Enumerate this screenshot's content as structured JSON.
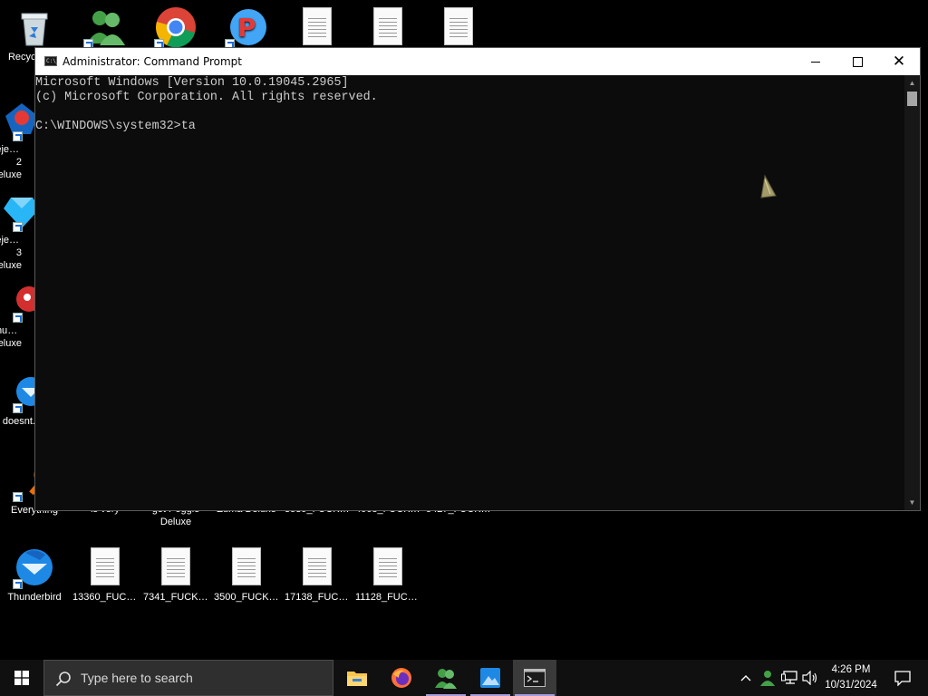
{
  "desktop": {
    "icons_left": [
      {
        "label": "Recycle Bin",
        "icon": "recycle-bin-icon"
      },
      {
        "label": "Bejeweled 2 Deluxe",
        "icon": "bejeweled-2-icon"
      },
      {
        "label": "Bejeweled 3 Deluxe",
        "icon": "bejeweled-3-icon"
      },
      {
        "label": "Chuzzle Deluxe",
        "icon": "chuzzle-icon"
      },
      {
        "label": "doesnt...",
        "icon": "thunderbird-icon"
      },
      {
        "label": "Everything",
        "icon": "everything-search-icon"
      }
    ],
    "icons_top": [
      {
        "label": "",
        "icon": "people-app-icon"
      },
      {
        "label": "",
        "icon": "chrome-icon"
      },
      {
        "label": "",
        "icon": "peggle-icon"
      },
      {
        "label": "",
        "icon": "text-document-icon"
      },
      {
        "label": "",
        "icon": "text-document-icon"
      },
      {
        "label": "",
        "icon": "text-document-icon"
      }
    ],
    "icons_row_partial": [
      {
        "label": "is very",
        "icon": "shortcut"
      },
      {
        "label": "get Peggle Deluxe",
        "icon": "peggle-icon"
      },
      {
        "label": "Zuma Deluxe",
        "icon": "zuma-icon"
      },
      {
        "label": "3539_FUCK_...",
        "icon": "text-document-icon"
      },
      {
        "label": "4068_FUCK_...",
        "icon": "text-document-icon"
      },
      {
        "label": "5427_FUCK_...",
        "icon": "text-document-icon"
      }
    ],
    "icons_bottom": [
      {
        "label": "Thunderbird",
        "icon": "thunderbird-icon"
      },
      {
        "label": "13360_FUCK...",
        "icon": "text-document-icon"
      },
      {
        "label": "7341_FUCK_...",
        "icon": "text-document-icon"
      },
      {
        "label": "3500_FUCK_...",
        "icon": "text-document-icon"
      },
      {
        "label": "17138_FUCK...",
        "icon": "text-document-icon"
      },
      {
        "label": "11128_FUCK...",
        "icon": "text-document-icon"
      }
    ]
  },
  "window": {
    "title": "Administrator: Command Prompt",
    "console_lines": [
      "Microsoft Windows [Version 10.0.19045.2965]",
      "(c) Microsoft Corporation. All rights reserved.",
      "",
      "C:\\WINDOWS\\system32>ta"
    ],
    "controls": {
      "minimize": "minimize",
      "maximize": "maximize",
      "close": "close"
    }
  },
  "taskbar": {
    "search_placeholder": "Type here to search",
    "apps": [
      {
        "name": "file-explorer",
        "running": false
      },
      {
        "name": "firefox",
        "running": false
      },
      {
        "name": "people-app",
        "running": true
      },
      {
        "name": "photos-app",
        "running": true
      },
      {
        "name": "command-prompt",
        "running": true,
        "active": true
      }
    ],
    "clock_time": "4:26 PM",
    "clock_date": "10/31/2024"
  },
  "colors": {
    "console_bg": "#0c0c0c",
    "console_text": "#cccccc",
    "taskbar_bg": "#101010",
    "running_indicator": "#a99bd8"
  }
}
